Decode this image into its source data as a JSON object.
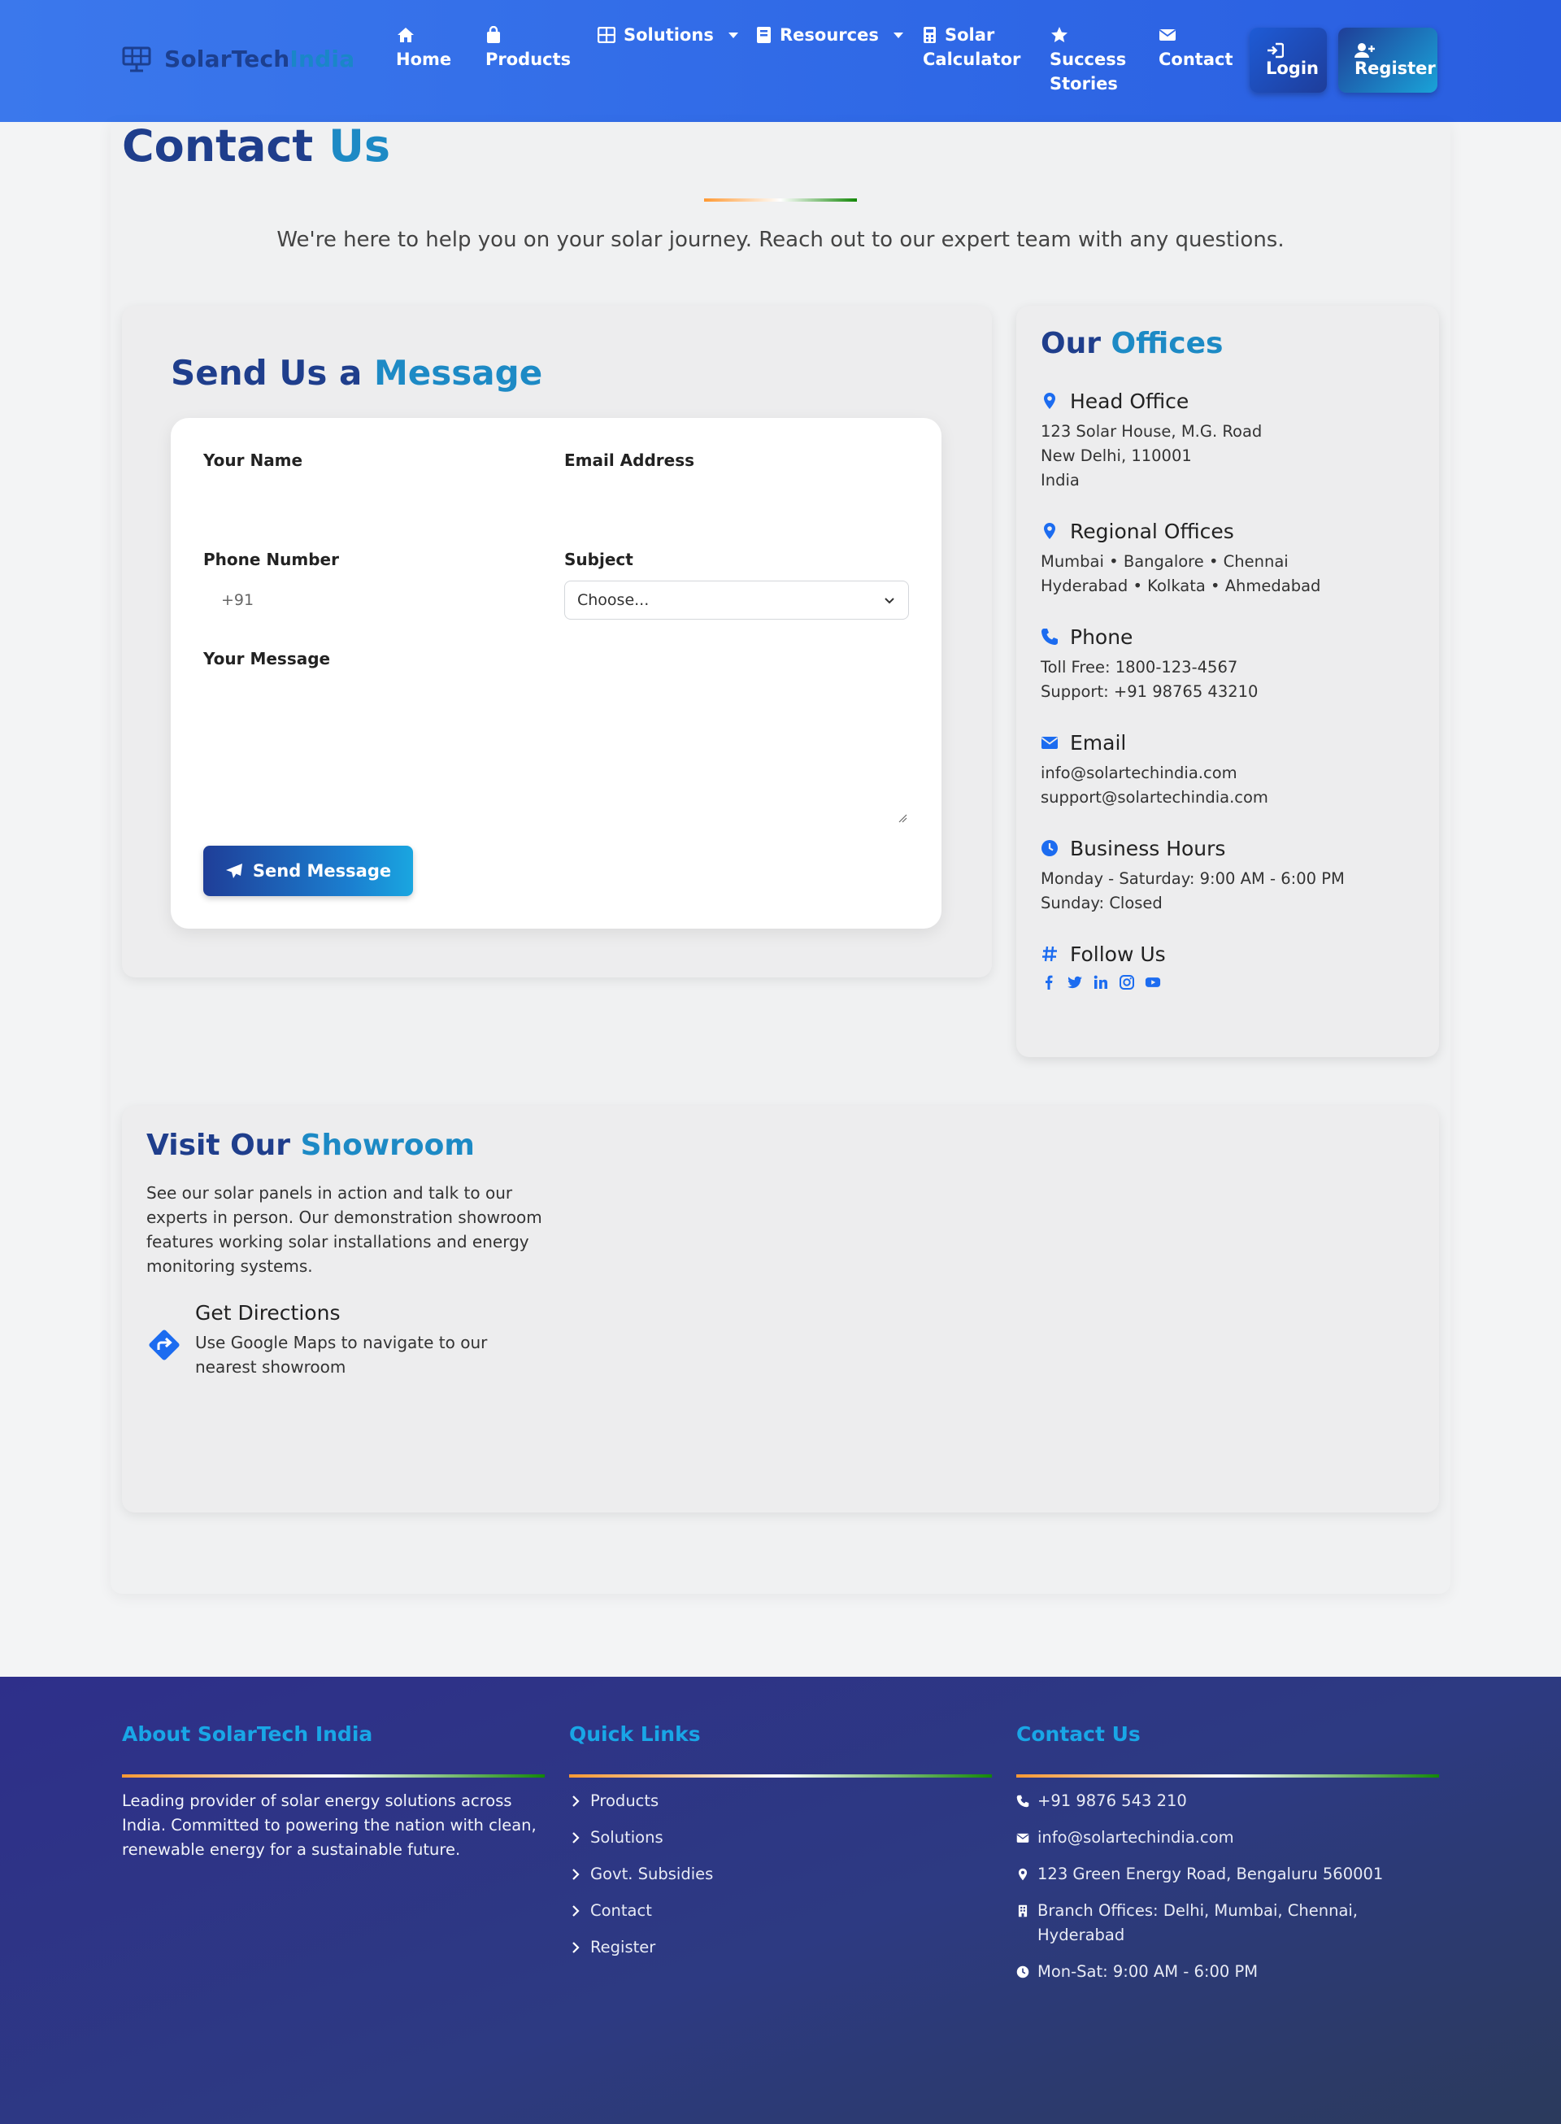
{
  "brand": {
    "name_part1": "SolarTech",
    "name_part2": "India"
  },
  "nav": {
    "home": "Home",
    "products": "Products",
    "solutions": "Solutions",
    "resources": "Resources",
    "calculator_l1": "Solar",
    "calculator_l2": "Calculator",
    "stories_l1": "Success",
    "stories_l2": "Stories",
    "contact": "Contact",
    "login": "Login",
    "register": "Register"
  },
  "page": {
    "title_part1": "Contact",
    "title_part2": "Us",
    "subtitle": "We're here to help you on your solar journey. Reach out to our expert team with any questions."
  },
  "form": {
    "heading_part1": "Send Us a",
    "heading_part2": "Message",
    "name_label": "Your Name",
    "email_label": "Email Address",
    "phone_label": "Phone Number",
    "phone_prefix": "+91",
    "subject_label": "Subject",
    "subject_selected": "Choose...",
    "message_label": "Your Message",
    "submit_label": "Send Message"
  },
  "offices": {
    "title_part1": "Our",
    "title_part2": "Offices",
    "head": {
      "title": "Head Office",
      "line1": "123 Solar House, M.G. Road",
      "line2": "New Delhi, 110001",
      "line3": "India"
    },
    "regional": {
      "title": "Regional Offices",
      "line1": "Mumbai • Bangalore • Chennai",
      "line2": "Hyderabad • Kolkata • Ahmedabad"
    },
    "phone": {
      "title": "Phone",
      "line1": "Toll Free: 1800-123-4567",
      "line2": "Support: +91 98765 43210"
    },
    "email": {
      "title": "Email",
      "line1": "info@solartechindia.com",
      "line2": "support@solartechindia.com"
    },
    "hours": {
      "title": "Business Hours",
      "line1": "Monday - Saturday: 9:00 AM - 6:00 PM",
      "line2": "Sunday: Closed"
    },
    "follow": {
      "title": "Follow Us"
    }
  },
  "showroom": {
    "title_part1": "Visit Our",
    "title_part2": "Showroom",
    "description": "See our solar panels in action and talk to our experts in person. Our demonstration showroom features working solar installations and energy monitoring systems.",
    "directions_title": "Get Directions",
    "directions_desc": "Use Google Maps to navigate to our nearest showroom"
  },
  "footer": {
    "about_title": "About SolarTech India",
    "about_text": "Leading provider of solar energy solutions across India. Committed to powering the nation with clean, renewable energy for a sustainable future.",
    "links_title": "Quick Links",
    "links": [
      "Products",
      "Solutions",
      "Govt. Subsidies",
      "Contact",
      "Register"
    ],
    "contact_title": "Contact Us",
    "contact_phone": "+91 9876 543 210",
    "contact_email": "info@solartechindia.com",
    "contact_address": "123 Green Energy Road, Bengaluru 560001",
    "contact_branches": "Branch Offices: Delhi, Mumbai, Chennai, Hyderabad",
    "contact_hours": "Mon-Sat: 9:00 AM - 6:00 PM"
  },
  "colors": {
    "primary_blue": "#2f68e6",
    "navy": "#1f3e8c",
    "accent_cyan": "#1d8ac5",
    "icon_blue": "#1c6cf0",
    "footer_accent": "#19a6e6"
  },
  "icons": {
    "brand": "solar-panel-icon",
    "home": "home-icon",
    "products": "shopping-bag-icon",
    "solutions": "grid-icon",
    "resources": "book-icon",
    "calculator": "calculator-icon",
    "stories": "star-icon",
    "contact": "envelope-icon",
    "login": "sign-in-icon",
    "register": "user-plus-icon"
  }
}
